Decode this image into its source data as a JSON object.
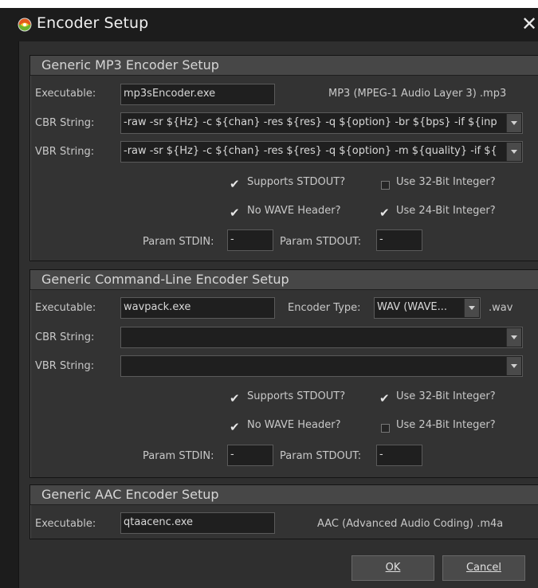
{
  "window": {
    "title": "Encoder Setup",
    "close_glyph": "✕"
  },
  "mp3": {
    "title": "Generic MP3 Encoder Setup",
    "executable_label": "Executable:",
    "executable_value": "mp3sEncoder.exe",
    "format_text": "MP3 (MPEG-1 Audio Layer 3) .mp3",
    "cbr_label": "CBR String:",
    "cbr_value": "-raw -sr ${Hz} -c ${chan} -res ${res} -q ${option} -br ${bps} -if ${inp",
    "vbr_label": "VBR String:",
    "vbr_value": "-raw -sr ${Hz} -c ${chan} -res ${res} -q ${option} -m ${quality} -if ${",
    "supports_stdout": {
      "label": "Supports STDOUT?",
      "checked": true
    },
    "use_32bit": {
      "label": "Use 32-Bit Integer?",
      "checked": false
    },
    "no_wave_header": {
      "label": "No WAVE Header?",
      "checked": true
    },
    "use_24bit": {
      "label": "Use 24-Bit Integer?",
      "checked": true
    },
    "param_stdin_label": "Param STDIN:",
    "param_stdin_value": "-",
    "param_stdout_label": "Param STDOUT:",
    "param_stdout_value": "-"
  },
  "cmdline": {
    "title": "Generic Command-Line Encoder Setup",
    "executable_label": "Executable:",
    "executable_value": "wavpack.exe",
    "encoder_type_label": "Encoder Type:",
    "encoder_type_value": "WAV (WAVE...",
    "extension": ".wav",
    "cbr_label": "CBR String:",
    "cbr_value": "",
    "vbr_label": "VBR String:",
    "vbr_value": "",
    "supports_stdout": {
      "label": "Supports STDOUT?",
      "checked": true
    },
    "use_32bit": {
      "label": "Use 32-Bit Integer?",
      "checked": true
    },
    "no_wave_header": {
      "label": "No WAVE Header?",
      "checked": true
    },
    "use_24bit": {
      "label": "Use 24-Bit Integer?",
      "checked": false
    },
    "param_stdin_label": "Param STDIN:",
    "param_stdin_value": "-",
    "param_stdout_label": "Param STDOUT:",
    "param_stdout_value": "-"
  },
  "aac": {
    "title": "Generic AAC Encoder Setup",
    "executable_label": "Executable:",
    "executable_value": "qtaacenc.exe",
    "format_text": "AAC (Advanced Audio Coding) .m4a"
  },
  "buttons": {
    "ok": "OK",
    "cancel": "Cancel"
  }
}
